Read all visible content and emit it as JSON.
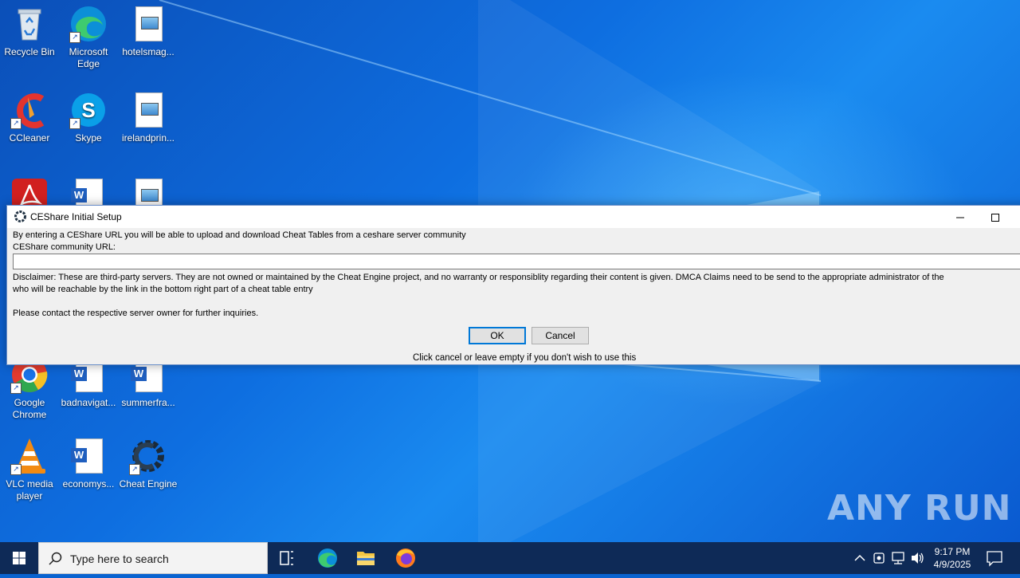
{
  "desktop": {
    "icons": [
      {
        "label": "Recycle Bin",
        "icon": "recycle-bin-icon"
      },
      {
        "label": "Microsoft Edge",
        "icon": "edge-icon"
      },
      {
        "label": "hotelsmag...",
        "icon": "image-file-icon"
      },
      {
        "label": "CCleaner",
        "icon": "ccleaner-icon"
      },
      {
        "label": "Skype",
        "icon": "skype-icon"
      },
      {
        "label": "irelandprin...",
        "icon": "image-file-icon"
      },
      {
        "label": "Google Chrome",
        "icon": "chrome-icon"
      },
      {
        "label": "badnavigat...",
        "icon": "word-doc-icon"
      },
      {
        "label": "summerfra...",
        "icon": "word-doc-icon"
      },
      {
        "label": "VLC media player",
        "icon": "vlc-icon"
      },
      {
        "label": "economys...",
        "icon": "word-doc-icon"
      },
      {
        "label": "Cheat Engine",
        "icon": "cheat-engine-icon"
      }
    ],
    "watermark": "ANY RUN"
  },
  "dialog": {
    "title": "CEShare Initial Setup",
    "intro": "By entering a CEShare URL you will be able to upload and download Cheat Tables from a ceshare server community",
    "url_label": "CEShare community URL:",
    "url_value": "",
    "disclaimer_line1": "Disclaimer: These are third-party servers. They are not owned or maintained by the Cheat Engine project, and no warranty or responsiblity regarding their content is given.  DMCA Claims need to be send to the appropriate administrator of the",
    "disclaimer_line2": "who will be reachable by the link in the bottom right part of a cheat table entry",
    "contact": "Please contact the respective server owner for further inquiries.",
    "ok_label": "OK",
    "cancel_label": "Cancel",
    "hint": "Click cancel or leave empty if you don't wish to use this"
  },
  "taskbar": {
    "search_placeholder": "Type here to search",
    "time": "9:17 PM",
    "date": "4/9/2025"
  },
  "colors": {
    "desktop_blue": "#0a63d0",
    "taskbar": "#0e2a57",
    "accent": "#0078d7"
  }
}
